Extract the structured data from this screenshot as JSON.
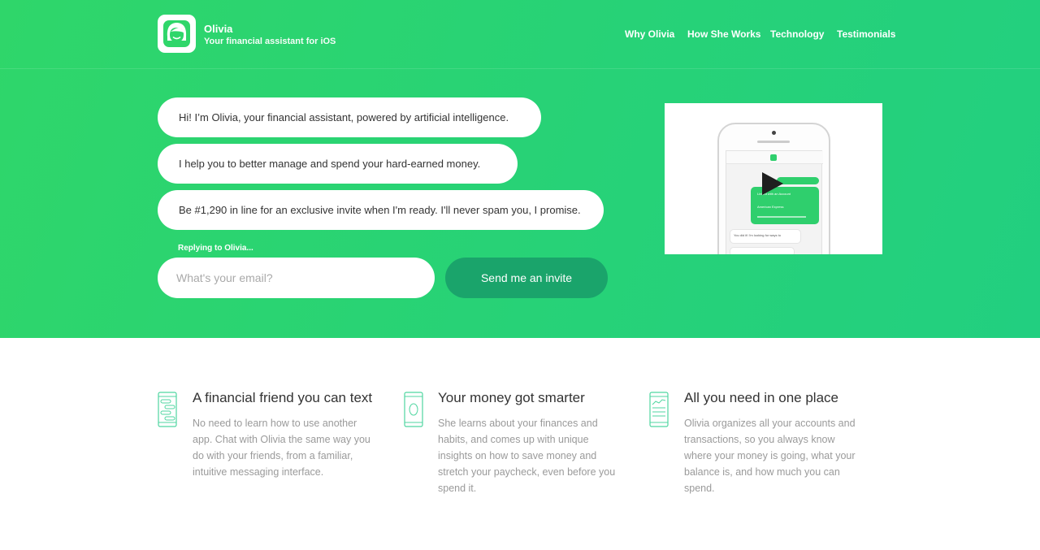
{
  "colors": {
    "brand_green": "#2fd66a",
    "button_green": "#1aa46b",
    "white": "#ffffff",
    "body_text": "#9a9a9a"
  },
  "header": {
    "logo_icon": "olivia-avatar-icon",
    "brand_name": "Olivia",
    "tagline": "Your financial assistant for iOS",
    "nav": [
      "Why Olivia",
      "How She Works",
      "Technology",
      "Testimonials"
    ]
  },
  "hero": {
    "messages": [
      "Hi! I’m Olivia, your financial assistant, powered by artificial intelligence.",
      "I help you to better manage and spend your hard-earned money.",
      "Be #1,290 in line for an exclusive invite when I'm ready. I'll never spam you, I promise."
    ],
    "replying_label": "Replying to Olivia...",
    "email_placeholder": "What's your email?",
    "email_value": "",
    "send_button": "Send me an invite",
    "video": {
      "icon": "play-icon",
      "screen_texts": [
        "Linked with an Account",
        "American Express",
        "You did it! I'm looking for ways to"
      ]
    }
  },
  "features": [
    {
      "icon": "chat-phone-icon",
      "title": "A financial friend you can text",
      "body": "No need to learn how to use another app. Chat with Olivia the same way you do with your friends, from a familiar, intuitive messaging interface."
    },
    {
      "icon": "smart-phone-icon",
      "title": "Your money got smarter",
      "body": "She learns about your finances and habits, and comes up with unique insights on how to save money and stretch your paycheck, even before you spend it."
    },
    {
      "icon": "chart-document-icon",
      "title": "All you need in one place",
      "body": "Olivia organizes all your accounts and transactions, so you always know where your money is going, what your balance is, and how much you can spend."
    }
  ]
}
